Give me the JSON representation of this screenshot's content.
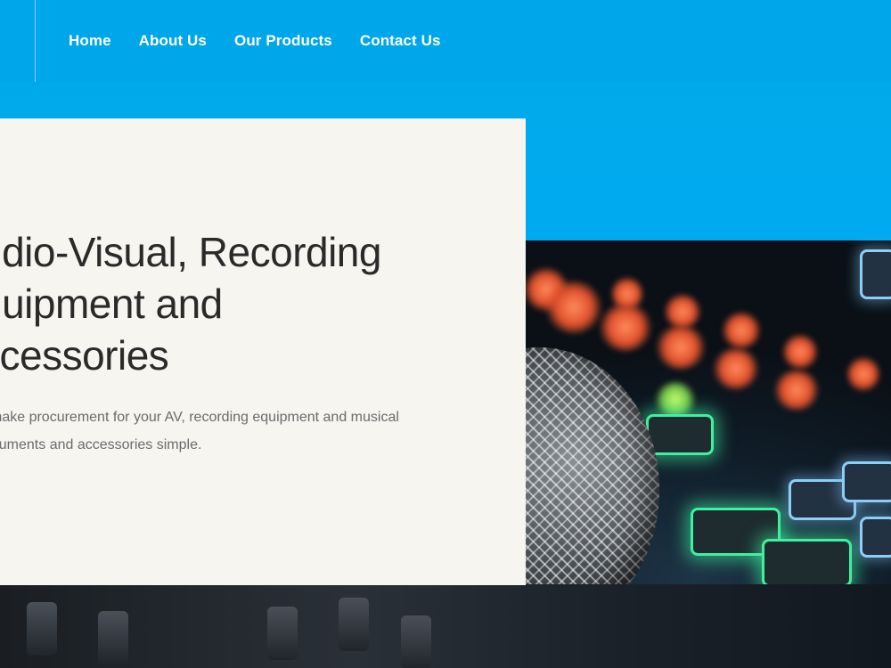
{
  "nav": {
    "items": [
      {
        "label": "Home"
      },
      {
        "label": "About Us"
      },
      {
        "label": "Our Products"
      },
      {
        "label": "Contact Us"
      }
    ]
  },
  "hero": {
    "title_line1": "udio-Visual, Recording",
    "title_line2": "quipment and",
    "title_line3": "ccessories",
    "subtitle_line1": "make procurement for your AV, recording equipment and musical",
    "subtitle_line2": "truments and accessories simple."
  },
  "colors": {
    "brand_blue": "#00a6ea",
    "card_bg": "#f6f5f0",
    "heading": "#2a2a2a",
    "body_text": "#6b6b6b"
  },
  "icons": {
    "hero_image": "studio-microphone-mixer-photo"
  }
}
